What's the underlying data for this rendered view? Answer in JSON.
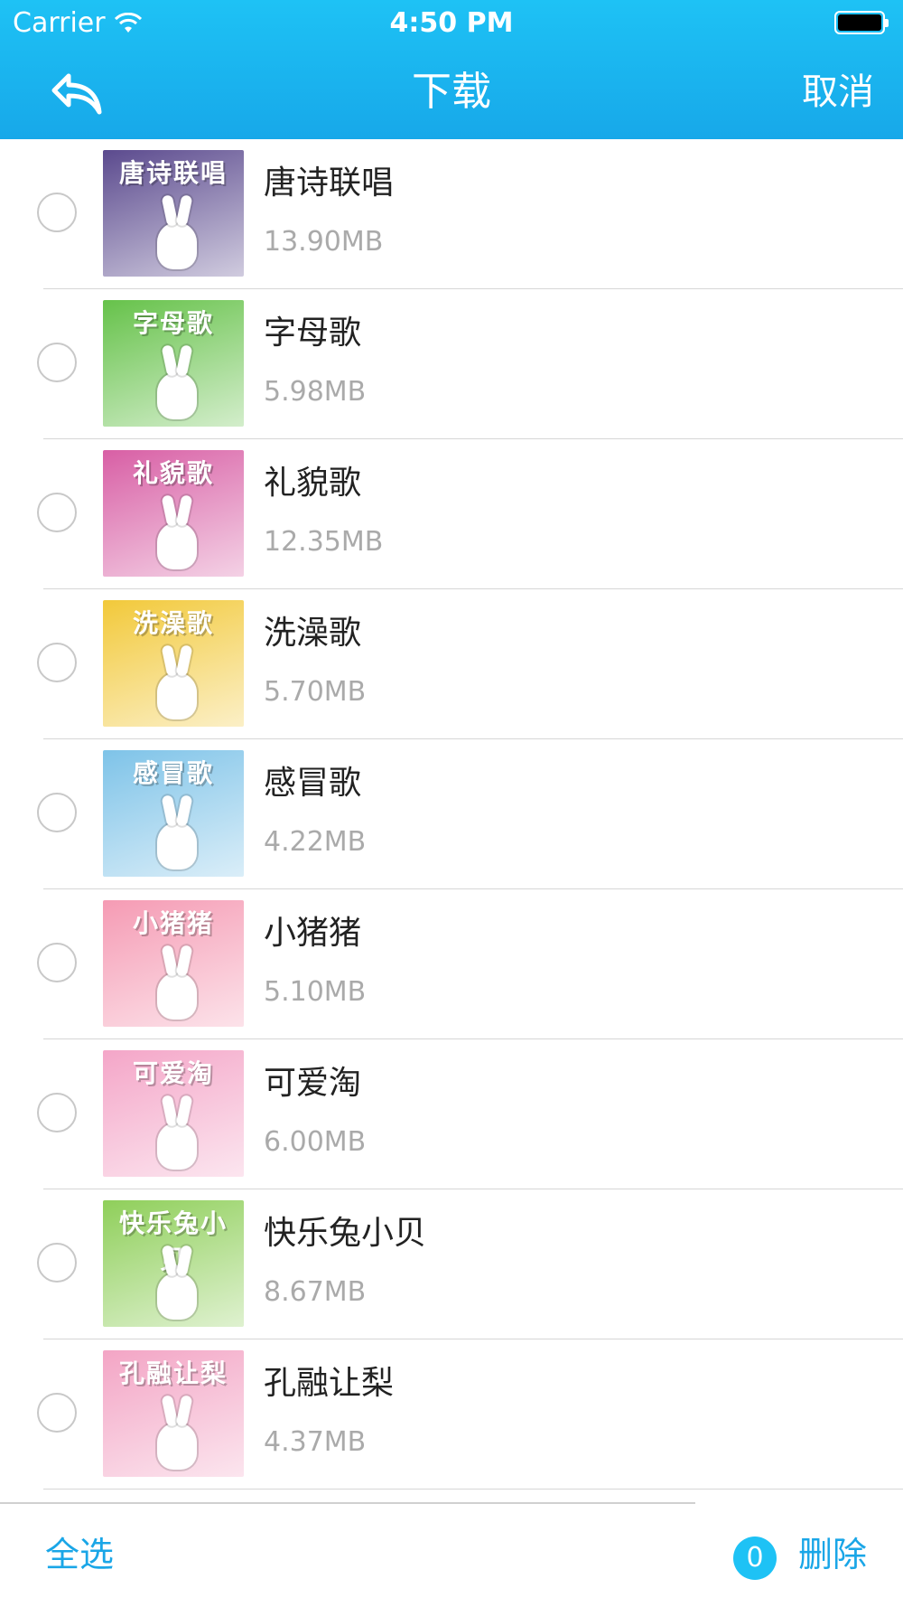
{
  "status_bar": {
    "carrier": "Carrier",
    "time": "4:50 PM"
  },
  "nav": {
    "title": "下载",
    "cancel_label": "取消",
    "back_icon": "back-arrow-icon"
  },
  "items": [
    {
      "title": "唐诗联唱",
      "size": "13.90MB",
      "thumb_text": "唐诗联唱",
      "thumb_color": "#5b4a8e"
    },
    {
      "title": "字母歌",
      "size": "5.98MB",
      "thumb_text": "字母歌",
      "thumb_color": "#66c24a"
    },
    {
      "title": "礼貌歌",
      "size": "12.35MB",
      "thumb_text": "礼貌歌",
      "thumb_color": "#d85fa5"
    },
    {
      "title": "洗澡歌",
      "size": "5.70MB",
      "thumb_text": "洗澡歌",
      "thumb_color": "#f2c93a"
    },
    {
      "title": "感冒歌",
      "size": "4.22MB",
      "thumb_text": "感冒歌",
      "thumb_color": "#7ec3e8"
    },
    {
      "title": "小猪猪",
      "size": "5.10MB",
      "thumb_text": "小猪猪",
      "thumb_color": "#f59bb4"
    },
    {
      "title": "可爱淘",
      "size": "6.00MB",
      "thumb_text": "可爱淘",
      "thumb_color": "#f4a6c8"
    },
    {
      "title": "快乐兔小贝",
      "size": "8.67MB",
      "thumb_text": "快乐兔小贝",
      "thumb_color": "#8fcf5a"
    },
    {
      "title": "孔融让梨",
      "size": "4.37MB",
      "thumb_text": "孔融让梨",
      "thumb_color": "#f3a5c5"
    }
  ],
  "footer": {
    "select_all_label": "全选",
    "selected_count": "0",
    "delete_label": "删除"
  },
  "colors": {
    "accent": "#1aa6e7",
    "header": "#1ec2f5"
  }
}
